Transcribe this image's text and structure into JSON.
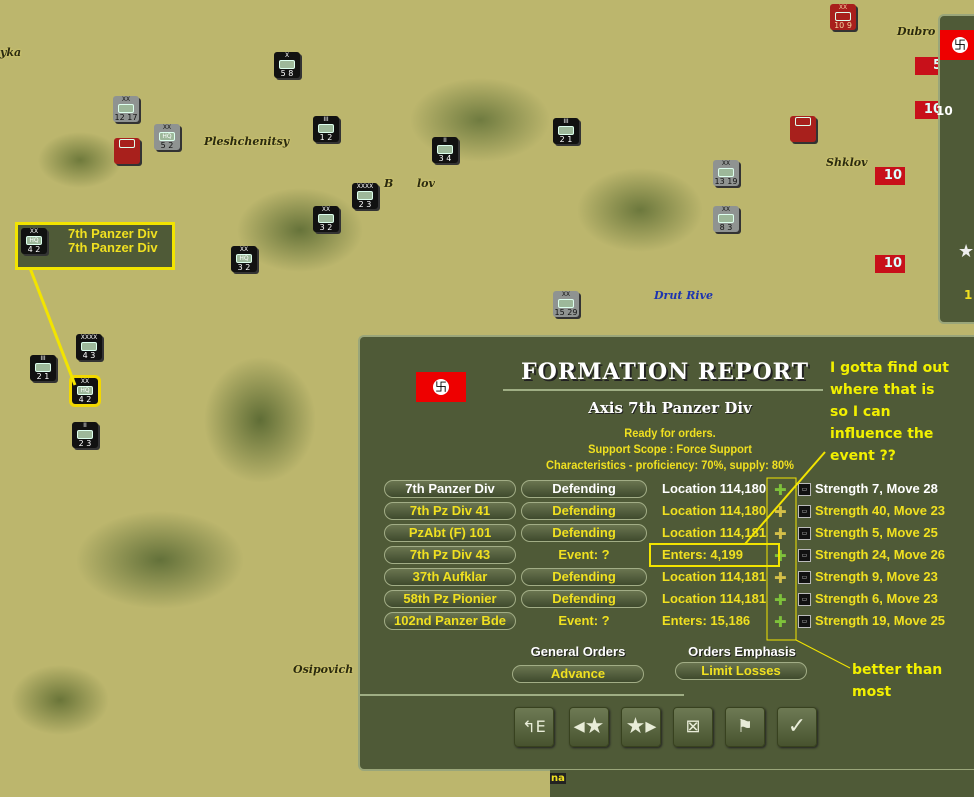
{
  "map": {
    "labels": [
      "yka",
      "Pleshchenitsy",
      "Shklov",
      "Dubro",
      "Drut Rive",
      "Osipovich",
      "B",
      "lov"
    ],
    "counters": [
      {
        "top": "X",
        "a": "5",
        "b": "8"
      },
      {
        "top": "III",
        "a": "1",
        "b": "2"
      },
      {
        "top": "XX",
        "a": "3",
        "b": "2"
      },
      {
        "top": "II",
        "a": "3",
        "b": "4"
      },
      {
        "top": "XXXX",
        "a": "2",
        "b": "3"
      },
      {
        "top": "III",
        "a": "2",
        "b": "1"
      },
      {
        "top": "XX",
        "a": "3",
        "b": "2"
      },
      {
        "top": "III",
        "a": "2",
        "b": "1"
      },
      {
        "top": "XX",
        "a": "4",
        "b": "2"
      },
      {
        "top": "II",
        "a": "2",
        "b": "3"
      },
      {
        "top": "XXXX",
        "a": "4",
        "b": "3"
      },
      {
        "top": "XX",
        "a": "5",
        "b": "2"
      },
      {
        "top": "XX",
        "a": "12",
        "b": "17"
      },
      {
        "top": "XX",
        "a": "15",
        "b": "29"
      },
      {
        "top": "XX",
        "a": "10",
        "b": "9"
      },
      {
        "top": "XX",
        "a": "13",
        "b": "19"
      },
      {
        "top": "XX",
        "a": "8",
        "b": "3"
      }
    ],
    "soviet_markers": [
      "5",
      "10",
      "10",
      "10"
    ]
  },
  "callout": {
    "line1": "7th Panzer Div",
    "line2": "7th Panzer Div",
    "counter": {
      "top": "XX",
      "a": "4",
      "b": "2",
      "sym": "HQ"
    }
  },
  "panel": {
    "title": "FORMATION REPORT",
    "formation": "Axis 7th Panzer Div",
    "status": "Ready for orders.",
    "support_scope": "Support Scope :  Force Support",
    "characteristics": "Characteristics - proficiency: 70%, supply: 80%",
    "units": [
      {
        "name": "7th Panzer Div",
        "order": "Defending",
        "loc": "Location 114,180",
        "strength": "Strength 7, Move 28",
        "plus": "green",
        "icon": "HQ",
        "white": true
      },
      {
        "name": "7th Pz Div 41",
        "order": "Defending",
        "loc": "Location 114,180",
        "strength": "Strength 40, Move 23",
        "plus": "yellow",
        "icon": "tank"
      },
      {
        "name": "PzAbt (F) 101",
        "order": "Defending",
        "loc": "Location 114,181",
        "strength": "Strength 5, Move 25",
        "plus": "yellow",
        "icon": "tank"
      },
      {
        "name": "7th Pz Div 43",
        "order": "Event: ?",
        "loc": "Enters: 4,199",
        "strength": "Strength 24, Move 26",
        "plus": "green",
        "icon": "tank"
      },
      {
        "name": "37th Aufklar",
        "order": "Defending",
        "loc": "Location 114,181",
        "strength": "Strength 9, Move 23",
        "plus": "yellow",
        "icon": "recon"
      },
      {
        "name": "58th Pz Pionier",
        "order": "Defending",
        "loc": "Location 114,181",
        "strength": "Strength 6, Move 23",
        "plus": "green",
        "icon": "engineer"
      },
      {
        "name": "102nd Panzer Bde",
        "order": "Event: ?",
        "loc": "Enters: 15,186",
        "strength": "Strength 19, Move 25",
        "plus": "green",
        "icon": "tank"
      }
    ],
    "general_orders_label": "General Orders",
    "general_orders_value": "Advance",
    "orders_emphasis_label": "Orders Emphasis",
    "orders_emphasis_value": "Limit Losses",
    "buttons": [
      "entry-turn",
      "previous-formation",
      "next-formation",
      "hq-report",
      "formation-tree",
      "confirm"
    ]
  },
  "annotations": {
    "note1": [
      "I gotta find out",
      "where that is",
      "so I can",
      "influence the",
      "event ??"
    ],
    "note2": [
      "better than",
      "most"
    ],
    "color": "#f2f000"
  },
  "right_panel": {
    "values": [
      "10",
      "1"
    ]
  },
  "status_bar": {
    "text": "na"
  }
}
